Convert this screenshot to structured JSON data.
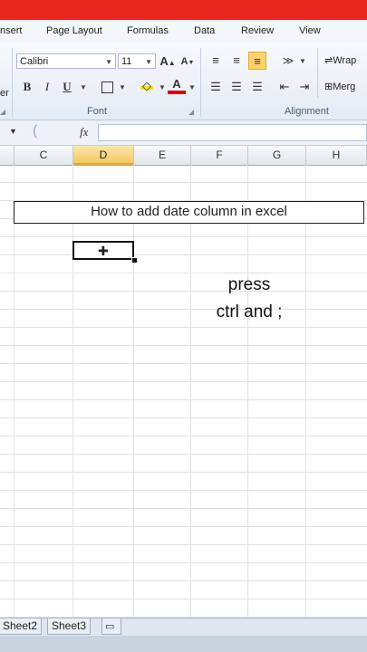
{
  "ribbon": {
    "tabs": [
      "nsert",
      "Page Layout",
      "Formulas",
      "Data",
      "Review",
      "View"
    ],
    "font_name": "Calibri",
    "font_size": "11",
    "wrap_label": "Wrap",
    "merge_label": "Merg",
    "font_group_label": "Font",
    "alignment_group_label": "Alignment",
    "left_partial_label": "er",
    "bold": "B",
    "italic": "I",
    "underline": "U",
    "font_color": "A",
    "grow_font": "A",
    "shrink_font": "A"
  },
  "formula_bar": {
    "fx_label": "fx",
    "circle_label": "(",
    "formula": ""
  },
  "columns": [
    "C",
    "D",
    "E",
    "F",
    "G",
    "H"
  ],
  "selected_column": "D",
  "sheet": {
    "title_box_text": "How to add date column in excel",
    "press_line1": "press",
    "press_line2": "ctrl and ;"
  },
  "sheet_tabs": [
    "Sheet2",
    "Sheet3"
  ],
  "colors": {
    "title_bar": "#e8261e",
    "selected_header": "#f5c965"
  }
}
